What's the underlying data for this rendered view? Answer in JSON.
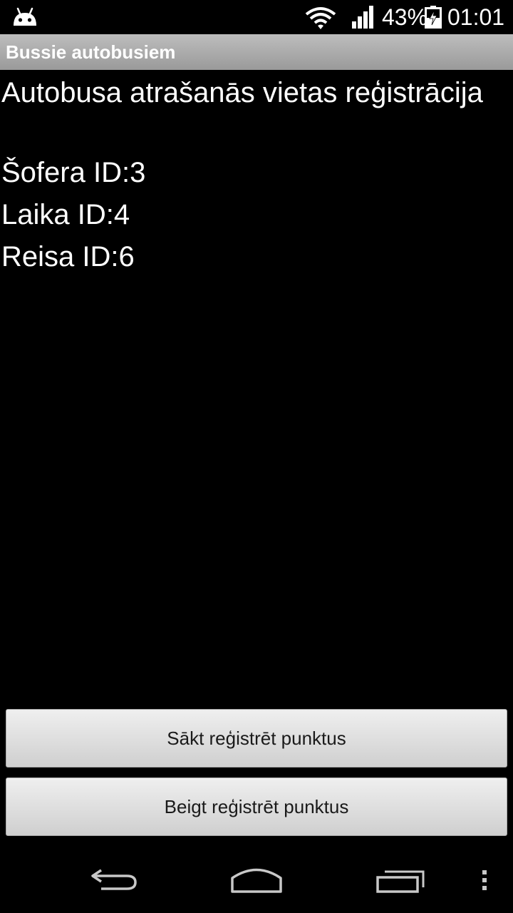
{
  "status_bar": {
    "battery_percent": "43%",
    "time": "01:01",
    "icons": [
      "android-icon",
      "wifi-icon",
      "signal-icon",
      "battery-charging-icon"
    ]
  },
  "app_bar": {
    "title": "Bussie autobusiem"
  },
  "main": {
    "heading": "Autobusa atrašanās vietas reģistrācija",
    "driver_id": "Šofera ID:3",
    "time_id": "Laika ID:4",
    "trip_id": "Reisa ID:6"
  },
  "buttons": {
    "start_label": "Sākt reģistrēt punktus",
    "stop_label": "Beigt reģistrēt punktus"
  },
  "nav_bar": {
    "icons": [
      "back-icon",
      "home-icon",
      "recent-apps-icon",
      "overflow-menu-icon"
    ]
  },
  "colors": {
    "background": "#000000",
    "title_bar": "#ababab",
    "button": "#dedede",
    "text": "#ffffff"
  }
}
